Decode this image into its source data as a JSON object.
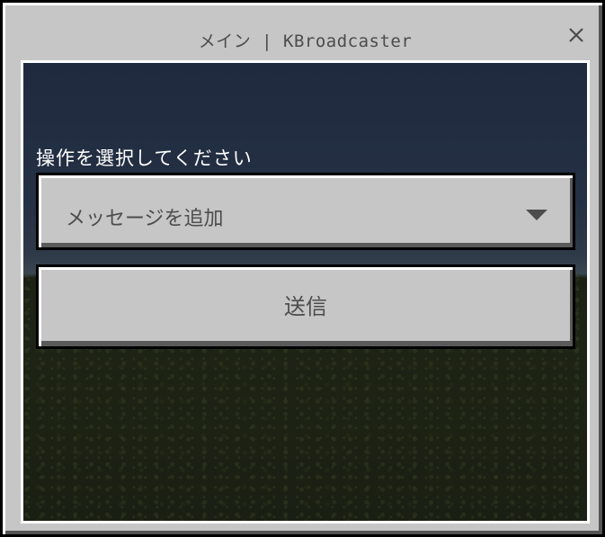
{
  "window": {
    "title": "メイン | KBroadcaster",
    "close_icon": "close-icon"
  },
  "form": {
    "prompt_label": "操作を選択してください",
    "action_select": {
      "selected": "メッセージを追加",
      "icon": "chevron-down-icon"
    },
    "submit_label": "送信"
  },
  "colors": {
    "panel": "#c6c6c6",
    "text": "#4c4c4c",
    "prompt_text": "#ffffff",
    "sky": "#243043",
    "ground": "#1c2113"
  }
}
